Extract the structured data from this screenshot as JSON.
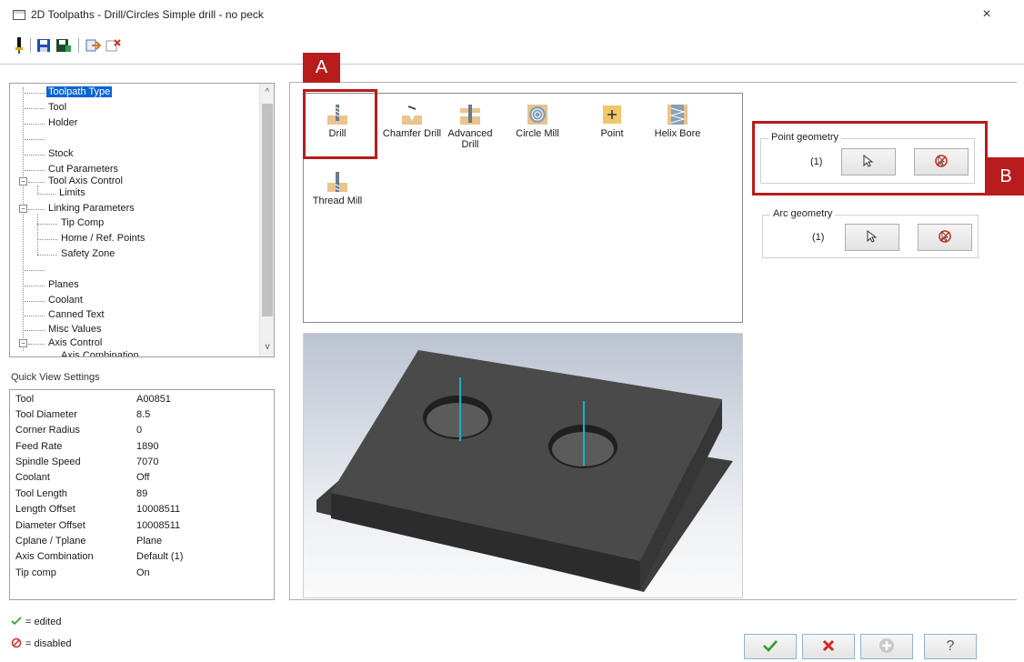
{
  "window": {
    "title": "2D Toolpaths - Drill/Circles Simple drill - no peck",
    "close_label": "×"
  },
  "toolbar": {
    "icons": [
      "tool-pin-icon",
      "save-icon",
      "save-as-icon",
      "import-icon",
      "delete-icon"
    ]
  },
  "tree": {
    "items": [
      {
        "label": "Toolpath Type",
        "level": 1,
        "selected": true
      },
      {
        "label": "Tool",
        "level": 1
      },
      {
        "label": "Holder",
        "level": 1
      },
      {
        "label": "",
        "level": 1
      },
      {
        "label": "Stock",
        "level": 1
      },
      {
        "label": "Cut Parameters",
        "level": 1
      },
      {
        "label": "Tool Axis Control",
        "level": 0,
        "collapse": "−"
      },
      {
        "label": "Limits",
        "level": 2
      },
      {
        "label": "Linking Parameters",
        "level": 0,
        "collapse": "−"
      },
      {
        "label": "Tip Comp",
        "level": 2
      },
      {
        "label": "Home / Ref. Points",
        "level": 2
      },
      {
        "label": "Safety Zone",
        "level": 2
      },
      {
        "label": "",
        "level": 1
      },
      {
        "label": "Planes",
        "level": 1
      },
      {
        "label": "Coolant",
        "level": 1
      },
      {
        "label": "Canned Text",
        "level": 1
      },
      {
        "label": "Misc Values",
        "level": 1
      },
      {
        "label": "Axis Control",
        "level": 0,
        "collapse": "−"
      },
      {
        "label": "Axis Combination",
        "level": 2
      }
    ]
  },
  "quick_view": {
    "title": "Quick View Settings",
    "rows": [
      {
        "key": "Tool",
        "value": "A00851"
      },
      {
        "key": "Tool Diameter",
        "value": "8.5"
      },
      {
        "key": "Corner Radius",
        "value": "0"
      },
      {
        "key": "Feed Rate",
        "value": "1890"
      },
      {
        "key": "Spindle Speed",
        "value": "7070"
      },
      {
        "key": "Coolant",
        "value": "Off"
      },
      {
        "key": "Tool Length",
        "value": "89"
      },
      {
        "key": "Length Offset",
        "value": "10008511"
      },
      {
        "key": "Diameter Offset",
        "value": "10008511"
      },
      {
        "key": "Cplane / Tplane",
        "value": "Plane"
      },
      {
        "key": "Axis Combination",
        "value": "Default (1)"
      },
      {
        "key": "Tip comp",
        "value": "On"
      }
    ]
  },
  "legend": {
    "edited": "= edited",
    "disabled": "= disabled"
  },
  "toolpath_types": [
    {
      "label": "Drill",
      "icon": "drill-icon"
    },
    {
      "label": "Chamfer Drill",
      "icon": "chamfer-drill-icon"
    },
    {
      "label": "Advanced Drill",
      "icon": "advanced-drill-icon"
    },
    {
      "label": "Circle Mill",
      "icon": "circle-mill-icon"
    },
    {
      "label": "Point",
      "icon": "point-icon"
    },
    {
      "label": "Helix Bore",
      "icon": "helix-bore-icon"
    },
    {
      "label": "Thread Mill",
      "icon": "thread-mill-icon"
    }
  ],
  "callouts": {
    "a": "A",
    "b": "B"
  },
  "point_geometry": {
    "title": "Point geometry",
    "count": "(1)"
  },
  "arc_geometry": {
    "title": "Arc geometry",
    "count": "(1)"
  },
  "buttons": {
    "ok": "ok-icon",
    "cancel": "cancel-icon",
    "add": "add-icon",
    "help": "help-icon"
  },
  "colors": {
    "selection": "#0a64d6",
    "callout": "#b81c1c",
    "ok_green": "#2a9d2a",
    "cancel_red": "#d42a1e"
  }
}
